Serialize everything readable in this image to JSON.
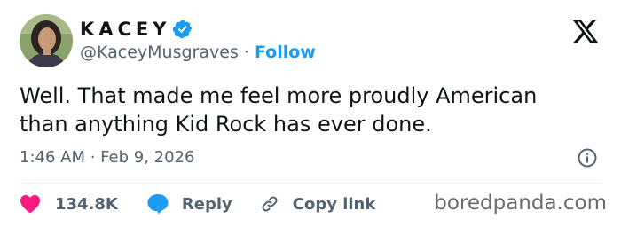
{
  "author": {
    "display_name": "KACEY",
    "handle": "@KaceyMusgraves",
    "separator": " · ",
    "follow_label": "Follow"
  },
  "tweet": {
    "lines": [
      "Well. That made me feel more proudly American",
      "than anything Kid Rock has ever done."
    ],
    "timestamp": "1:46 AM · Feb 9, 2026"
  },
  "actions": {
    "likes": "134.8K",
    "reply_label": "Reply",
    "copy_link_label": "Copy link"
  },
  "watermark": "boredpanda.com",
  "colors": {
    "accent": "#1d9bf0",
    "like": "#f91880",
    "text": "#0f1419",
    "secondary": "#536471"
  },
  "icons": [
    "x-logo-icon",
    "verified-badge-icon",
    "info-icon",
    "heart-icon",
    "reply-bubble-icon",
    "link-icon"
  ]
}
